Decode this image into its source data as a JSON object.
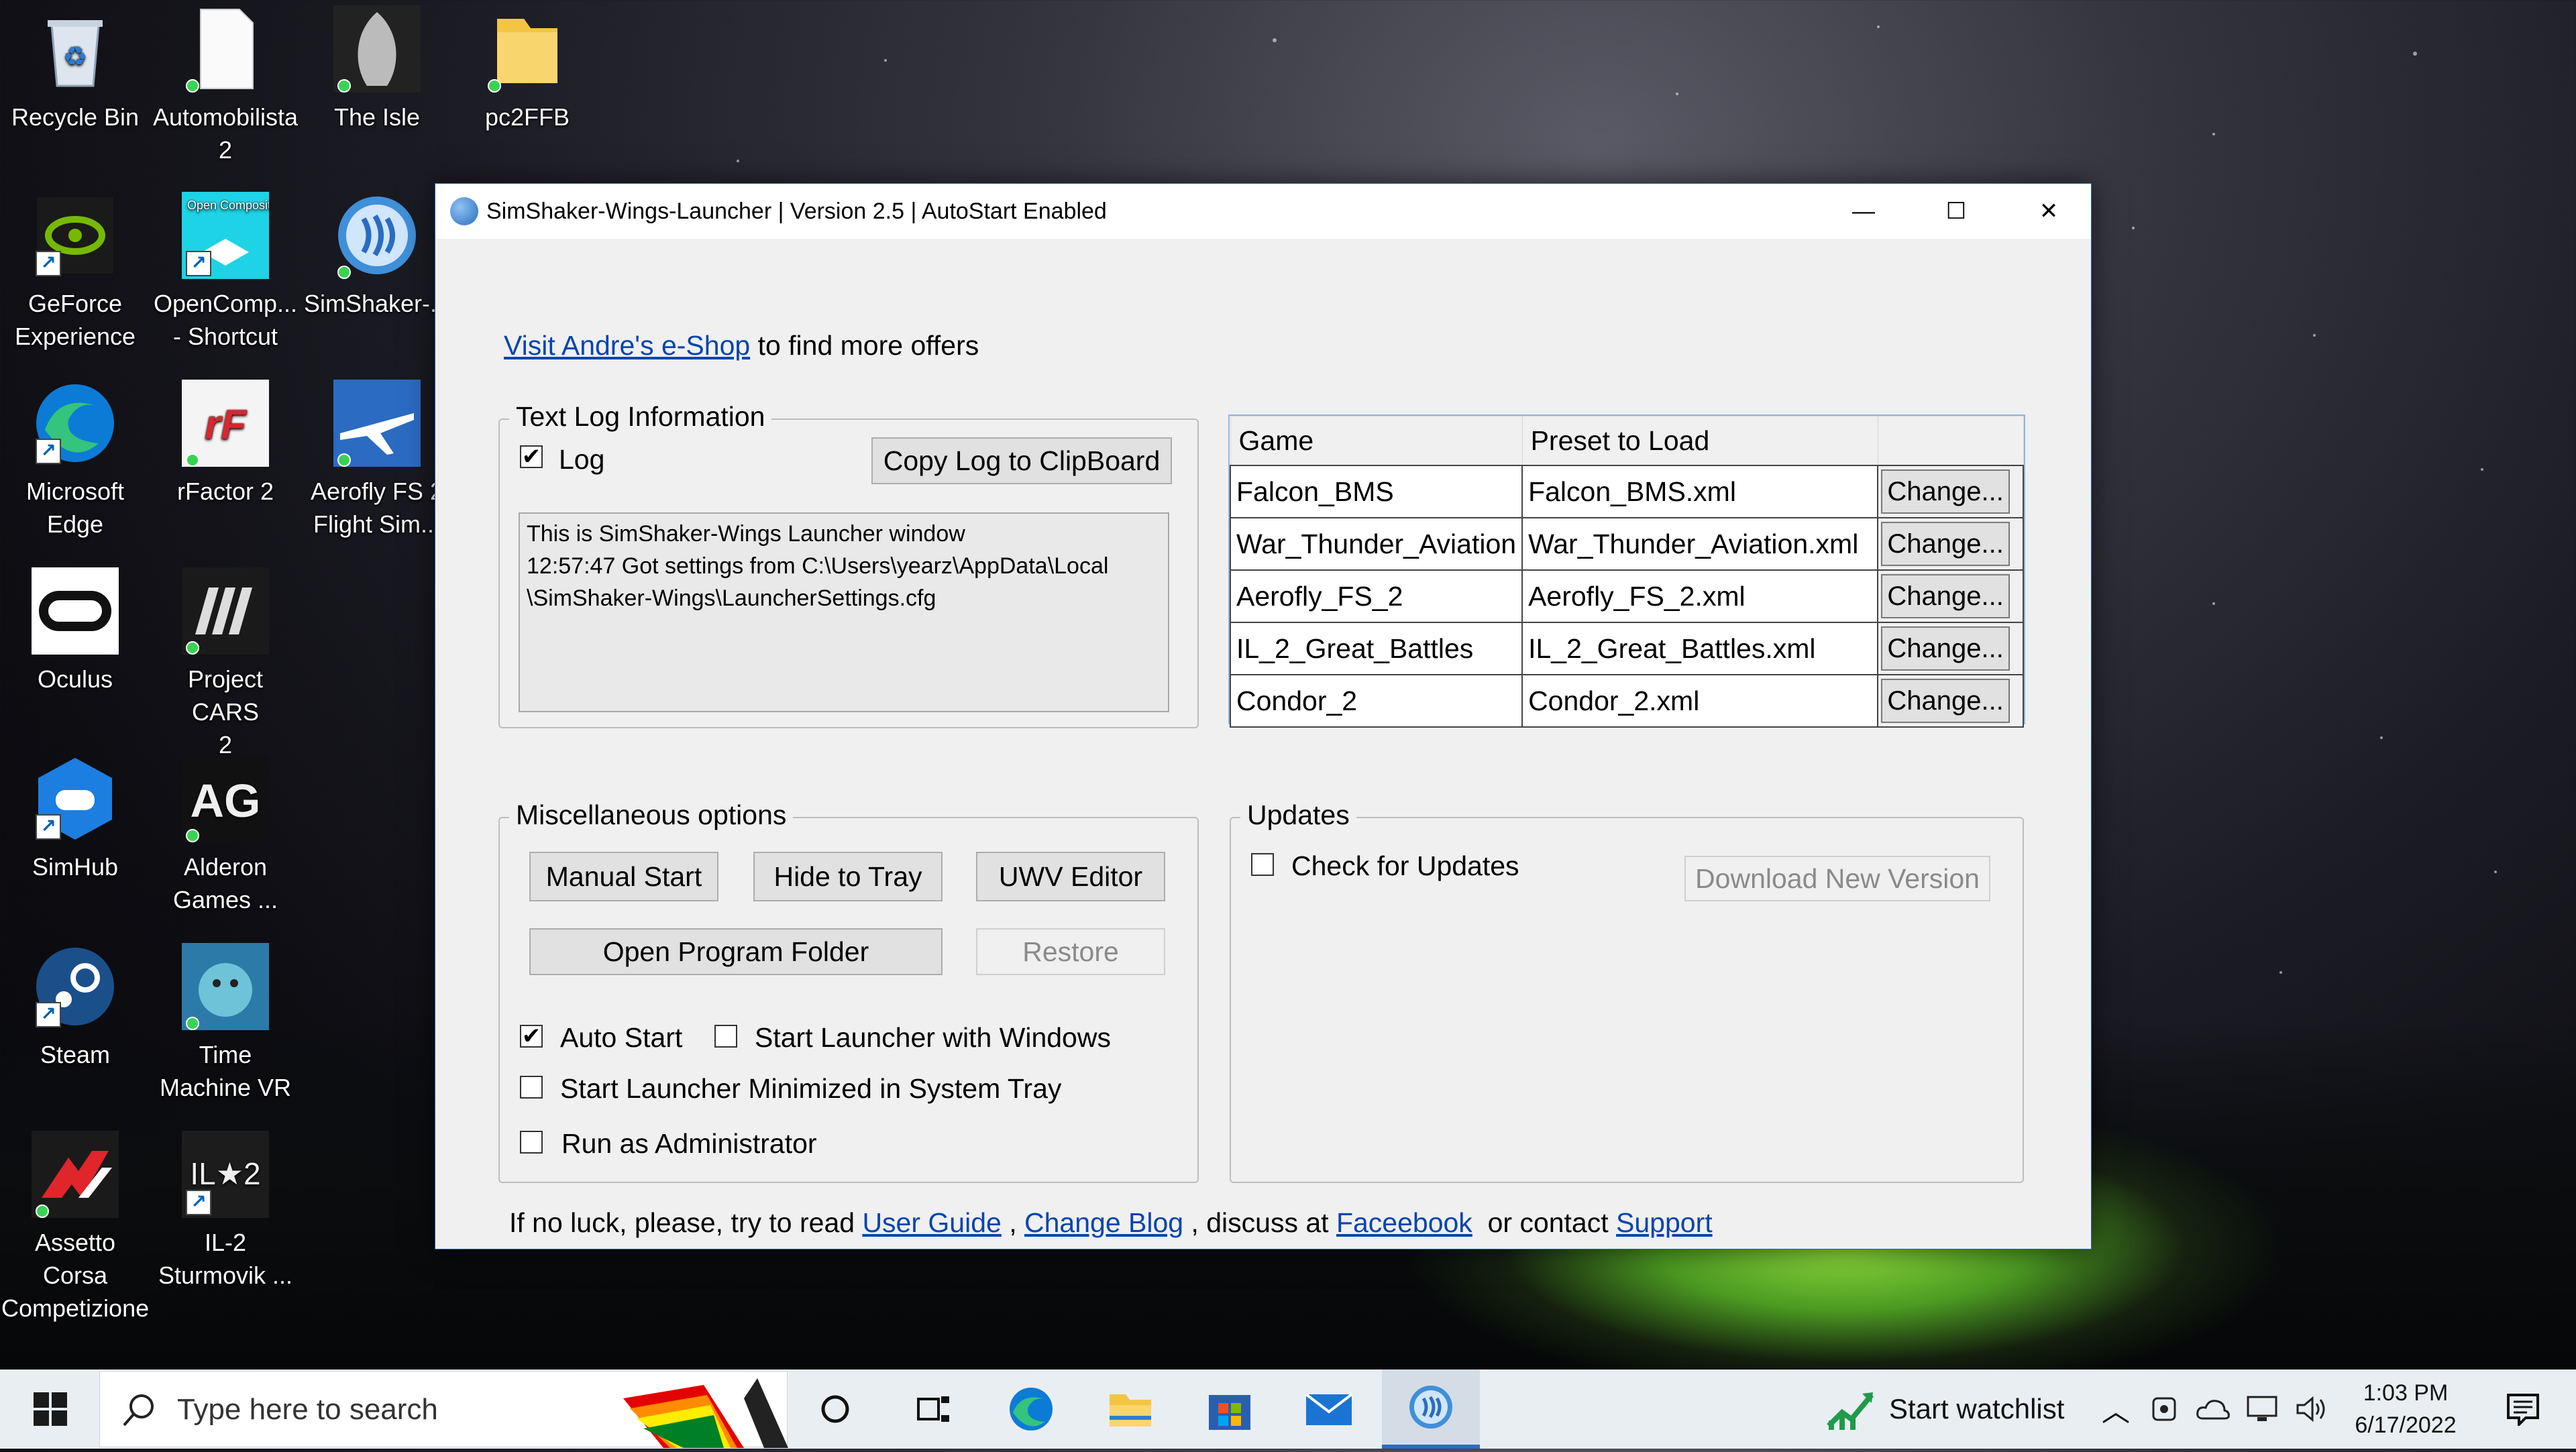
{
  "desktop": {
    "icons": [
      {
        "label_1": "Recycle Bin",
        "label_2": ""
      },
      {
        "label_1": "Automobilista",
        "label_2": "2"
      },
      {
        "label_1": "The Isle",
        "label_2": ""
      },
      {
        "label_1": "pc2FFB",
        "label_2": ""
      },
      {
        "label_1": "GeForce",
        "label_2": "Experience"
      },
      {
        "label_1": "OpenComp...",
        "label_2": "- Shortcut"
      },
      {
        "label_1": "SimShaker-...",
        "label_2": ""
      },
      {
        "label_1": "Microsoft",
        "label_2": "Edge"
      },
      {
        "label_1": "rFactor 2",
        "label_2": ""
      },
      {
        "label_1": "Aerofly FS 2",
        "label_2": "Flight Sim..."
      },
      {
        "label_1": "Oculus",
        "label_2": ""
      },
      {
        "label_1": "Project CARS",
        "label_2": "2"
      },
      {
        "label_1": "SimHub",
        "label_2": ""
      },
      {
        "label_1": "Alderon",
        "label_2": "Games ..."
      },
      {
        "label_1": "Steam",
        "label_2": ""
      },
      {
        "label_1": "Time",
        "label_2": "Machine VR"
      },
      {
        "label_1": "Assetto Corsa",
        "label_2": "Competizione"
      },
      {
        "label_1": "IL-2",
        "label_2": "Sturmovik ..."
      }
    ],
    "opencomp_badge": "Open Composite",
    "il2_badge": "IL★2"
  },
  "window": {
    "title": "SimShaker-Wings-Launcher |  Version 2.5 | AutoStart Enabled",
    "minimize": "—",
    "maximize": "☐",
    "close": "✕",
    "shop_link": "Visit Andre's e-Shop",
    "shop_suffix": " to find more offers",
    "log_group": {
      "title": "Text Log Information",
      "log_label": "Log",
      "log_checked": "✔",
      "copy_button": "Copy Log to ClipBoard",
      "log_lines": [
        "This is SimShaker-Wings Launcher window",
        "12:57:47 Got settings from C:\\Users\\yearz\\AppData\\Local",
        "\\SimShaker-Wings\\LauncherSettings.cfg"
      ]
    },
    "grid": {
      "headers": [
        "Game",
        "Preset to Load",
        ""
      ],
      "rows": [
        {
          "game": "Falcon_BMS",
          "preset": "Falcon_BMS.xml",
          "action": "Change..."
        },
        {
          "game": "War_Thunder_Aviation",
          "preset": "War_Thunder_Aviation.xml",
          "action": "Change..."
        },
        {
          "game": "Aerofly_FS_2",
          "preset": "Aerofly_FS_2.xml",
          "action": "Change..."
        },
        {
          "game": "IL_2_Great_Battles",
          "preset": "IL_2_Great_Battles.xml",
          "action": "Change..."
        },
        {
          "game": "Condor_2",
          "preset": "Condor_2.xml",
          "action": "Change..."
        }
      ]
    },
    "misc": {
      "title": "Miscellaneous options",
      "manual_start": "Manual Start",
      "hide_to_tray": "Hide to Tray",
      "uwv_editor": "UWV Editor",
      "open_folder": "Open Program Folder",
      "restore": "Restore",
      "auto_start": "Auto Start",
      "auto_start_checked": "✔",
      "start_with_windows": "Start Launcher with Windows",
      "start_minimized": "Start Launcher Minimized in System Tray",
      "run_as_admin": "Run as Administrator"
    },
    "updates": {
      "title": "Updates",
      "check_label": "Check for Updates",
      "download_button": "Download New Version"
    },
    "footer": {
      "prefix": "If no luck, please, try to read ",
      "user_guide": "User Guide",
      "sep1": " , ",
      "change_blog": "Change Blog",
      "mid": " , discuss at ",
      "facebook": "Faceebook",
      "or": "  or contact ",
      "support": "Support"
    }
  },
  "taskbar": {
    "search_placeholder": "Type here to search",
    "watchlist": "Start watchlist",
    "time": "1:03 PM",
    "date": "6/17/2022"
  }
}
